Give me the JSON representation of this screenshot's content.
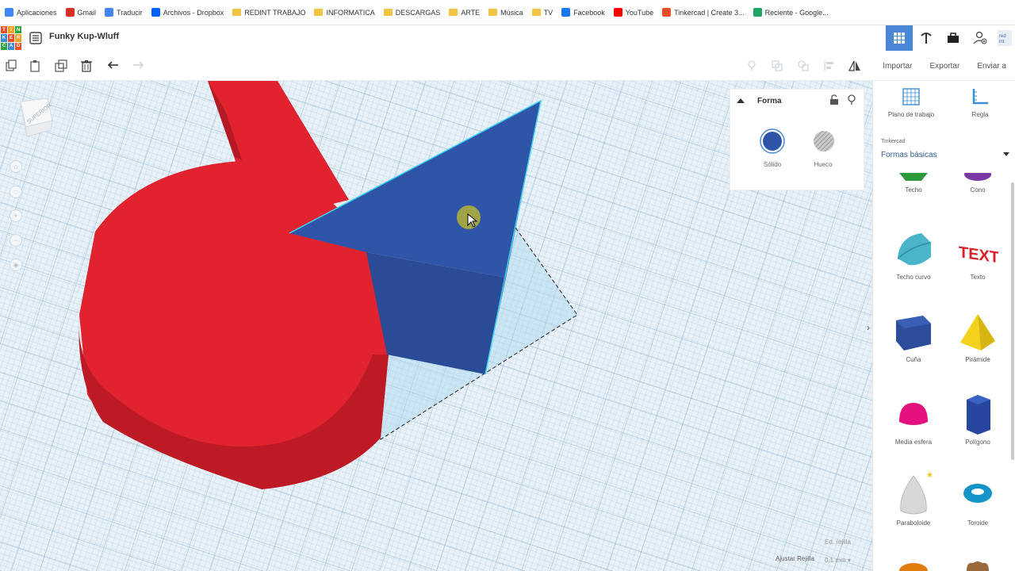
{
  "bookmarks": [
    {
      "label": "Aplicaciones",
      "icon": "apps-grid-icon",
      "color": "#4285f4"
    },
    {
      "label": "Gmail",
      "icon": "gmail-icon",
      "color": "#d93025"
    },
    {
      "label": "Traducir",
      "icon": "translate-icon",
      "color": "#4285f4"
    },
    {
      "label": "Archivos - Dropbox",
      "icon": "dropbox-icon",
      "color": "#0061ff"
    },
    {
      "label": "REDINT TRABAJO",
      "icon": "folder-icon",
      "color": "#f2c443"
    },
    {
      "label": "INFORMATICA",
      "icon": "folder-icon",
      "color": "#f2c443"
    },
    {
      "label": "DESCARGAS",
      "icon": "folder-icon",
      "color": "#f2c443"
    },
    {
      "label": "ARTE",
      "icon": "folder-icon",
      "color": "#f2c443"
    },
    {
      "label": "Música",
      "icon": "folder-icon",
      "color": "#f2c443"
    },
    {
      "label": "TV",
      "icon": "folder-icon",
      "color": "#f2c443"
    },
    {
      "label": "Facebook",
      "icon": "facebook-icon",
      "color": "#1877f2"
    },
    {
      "label": "YouTube",
      "icon": "youtube-icon",
      "color": "#ff0000"
    },
    {
      "label": "Tinkercad | Create 3...",
      "icon": "tinkercad-icon",
      "color": "#e94e2a"
    },
    {
      "label": "Reciente - Google...",
      "icon": "google-drive-icon",
      "color": "#1fa463"
    }
  ],
  "logo": {
    "letters": [
      "T",
      "I",
      "N",
      "K",
      "E",
      "R",
      "C",
      "A",
      "D"
    ]
  },
  "document": {
    "title": "Funky Kup-Wluff"
  },
  "toolbar": {
    "import_label": "Importar",
    "export_label": "Exportar",
    "send_label": "Enviar a"
  },
  "viewcube": {
    "label": "SUPERIOR"
  },
  "shape_panel": {
    "title": "Forma",
    "solid_label": "Sólido",
    "hole_label": "Hueco",
    "solid_color": "#2f55a8"
  },
  "sidebar": {
    "workplane_label": "Plano de trabajo",
    "ruler_label": "Regla",
    "library_small": "Tinkercad",
    "library_selected": "Formas básicas",
    "shapes": [
      {
        "label": "Techo"
      },
      {
        "label": "Cono"
      },
      {
        "label": "Techo curvo"
      },
      {
        "label": "Texto"
      },
      {
        "label": "Cuña"
      },
      {
        "label": "Pirámide"
      },
      {
        "label": "Media esfera"
      },
      {
        "label": "Polígono"
      },
      {
        "label": "Paraboloide"
      },
      {
        "label": "Toroide"
      }
    ]
  },
  "grid": {
    "edit_label": "Ed. rejilla",
    "snap_label": "Ajustar Rejilla",
    "snap_value": "0,1 mm"
  },
  "colors": {
    "red_shape": "#e0232f",
    "blue_shape": "#2f55a8",
    "accent": "#4a88d7"
  }
}
